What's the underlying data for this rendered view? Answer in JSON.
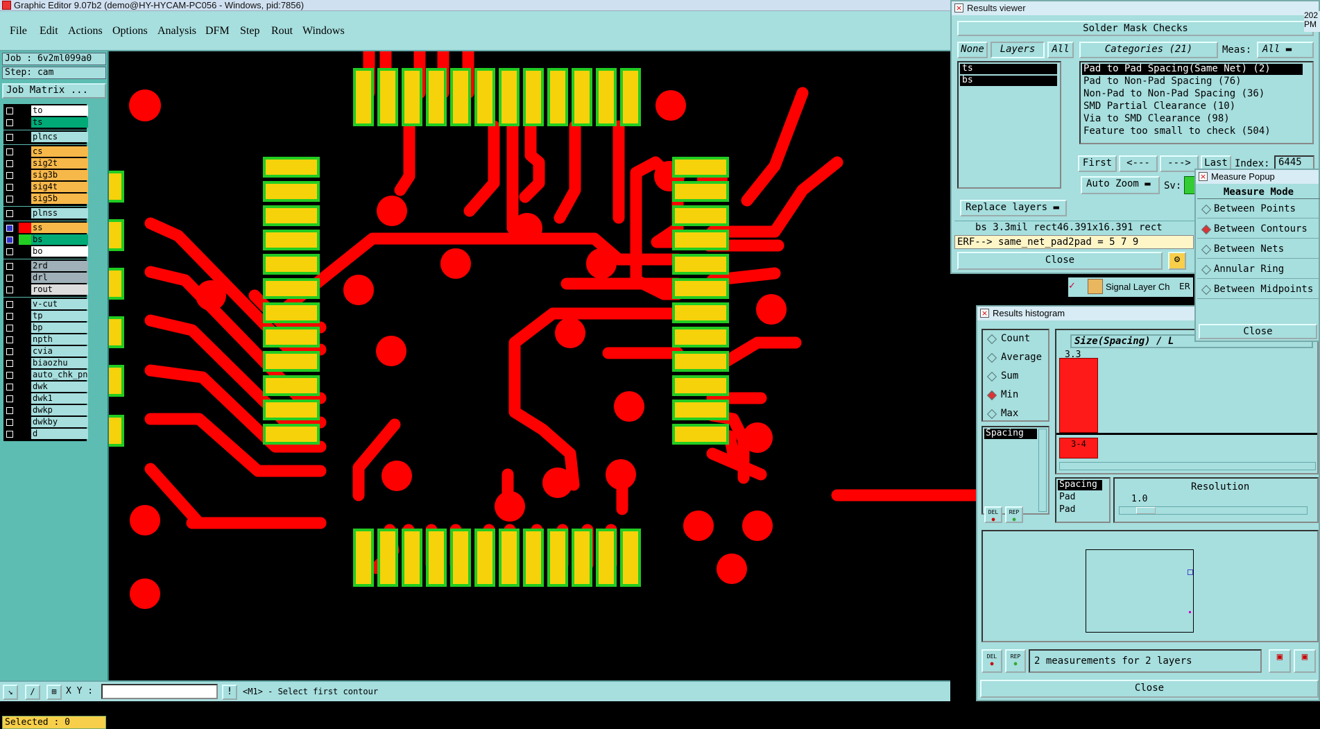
{
  "window_title": "Graphic Editor 9.07b2 (demo@HY-HYCAM-PC056 - Windows, pid:7856)",
  "menu": [
    "File",
    "Edit",
    "Actions",
    "Options",
    "Analysis",
    "DFM",
    "Step",
    "Rout",
    "Windows"
  ],
  "job": "Job : 6v2ml099a0",
  "step": "Step: cam",
  "job_matrix": "Job Matrix ...",
  "layers": [
    {
      "name": "to",
      "color": "#ffffff",
      "bg": "#ffffff",
      "sel": false
    },
    {
      "name": "ts",
      "color": "#00aa77",
      "bg": "#00aa77",
      "sel": false
    },
    {
      "name": "plncs",
      "color": "#000000",
      "bg": "#a7dede",
      "sel": false
    },
    {
      "name": "cs",
      "color": "#f7b84a",
      "bg": "#f7b84a",
      "sel": false
    },
    {
      "name": "sig2t",
      "color": "#f7b84a",
      "bg": "#f7b84a",
      "sel": false
    },
    {
      "name": "sig3b",
      "color": "#f7b84a",
      "bg": "#f7b84a",
      "sel": false
    },
    {
      "name": "sig4t",
      "color": "#f7b84a",
      "bg": "#f7b84a",
      "sel": false
    },
    {
      "name": "sig5b",
      "color": "#f7b84a",
      "bg": "#f7b84a",
      "sel": false
    },
    {
      "name": "plnss",
      "color": "#000000",
      "bg": "#a7dede",
      "sel": false
    },
    {
      "name": "ss",
      "color": "#ff0000",
      "bg": "#f7b84a",
      "sel": true
    },
    {
      "name": "bs",
      "color": "#22cc22",
      "bg": "#00aa77",
      "sel": true
    },
    {
      "name": "bo",
      "color": "#000000",
      "bg": "#ffffff",
      "sel": false
    },
    {
      "name": "2rd",
      "color": "#000000",
      "bg": "#9fb0b8",
      "sel": false
    },
    {
      "name": "drl",
      "color": "#000000",
      "bg": "#9fb0b8",
      "sel": false
    },
    {
      "name": "rout",
      "color": "#000000",
      "bg": "#dddddd",
      "sel": false
    },
    {
      "name": "v-cut",
      "color": "#000000",
      "bg": "#a7dede",
      "sel": false
    },
    {
      "name": "tp",
      "color": "#000000",
      "bg": "#a7dede",
      "sel": false
    },
    {
      "name": "bp",
      "color": "#000000",
      "bg": "#a7dede",
      "sel": false
    },
    {
      "name": "npth",
      "color": "#000000",
      "bg": "#a7dede",
      "sel": false
    },
    {
      "name": "cvia",
      "color": "#000000",
      "bg": "#a7dede",
      "sel": false
    },
    {
      "name": "biaozhu",
      "color": "#000000",
      "bg": "#a7dede",
      "sel": false
    },
    {
      "name": "auto_chk_pn:",
      "color": "#000000",
      "bg": "#a7dede",
      "sel": false
    },
    {
      "name": "dwk",
      "color": "#000000",
      "bg": "#a7dede",
      "sel": false
    },
    {
      "name": "dwk1",
      "color": "#000000",
      "bg": "#a7dede",
      "sel": false
    },
    {
      "name": "dwkp",
      "color": "#000000",
      "bg": "#a7dede",
      "sel": false
    },
    {
      "name": "dwkby",
      "color": "#000000",
      "bg": "#a7dede",
      "sel": false
    },
    {
      "name": "d",
      "color": "#000000",
      "bg": "#a7dede",
      "sel": false
    }
  ],
  "selected": "Selected : 0",
  "xy_label": "X Y :",
  "status_prompt": "<M1> - Select first contour",
  "results_viewer": {
    "title": "Results viewer",
    "header": "Solder Mask Checks",
    "none": "None",
    "layers": "Layers",
    "all": "All",
    "categories": "Categories (21)",
    "meas_label": "Meas:",
    "meas_value": "All",
    "layer_list": [
      "ts",
      "bs"
    ],
    "category_list": [
      "Pad to Pad Spacing(Same Net) (2)",
      "Pad to Non-Pad Spacing (76)",
      "Non-Pad to Non-Pad Spacing (36)",
      "SMD Partial Clearance (10)",
      "Via to SMD Clearance (98)",
      "Feature too small to check (504)"
    ],
    "first": "First",
    "prev": "<---",
    "next": "--->",
    "last": "Last",
    "index_label": "Index:",
    "index_value": "6445",
    "auto_zoom": "Auto Zoom",
    "sv": "Sv:",
    "replace_layers": "Replace layers",
    "info_line": "bs 3.3mil  rect46.391x16.391  rect",
    "erf_line": "ERF--> same_net_pad2pad = 5 7 9",
    "close": "Close"
  },
  "signal_layer": "Signal Layer Ch",
  "signal_suffix": "ER",
  "measure_popup": {
    "title": "Measure Popup",
    "mode_header": "Measure Mode",
    "modes": [
      "Between Points",
      "Between Contours",
      "Between Nets",
      "Annular Ring",
      "Between Midpoints"
    ],
    "selected_index": 1,
    "close": "Close"
  },
  "histogram": {
    "title": "Results histogram",
    "stats": [
      "Count",
      "Average",
      "Sum",
      "Min",
      "Max"
    ],
    "stat_selected": "Min",
    "spacing_label": "Spacing",
    "axis_title": "Size(Spacing) / L",
    "bar_value": "3.3",
    "bar_range": "3-4",
    "meas_types": [
      "Spacing",
      "Pad",
      "Pad"
    ],
    "resolution_label": "Resolution",
    "resolution_value": "1.0",
    "del": "DEL",
    "rep": "REP",
    "summary": "2 measurements for 2 layers",
    "close": "Close"
  },
  "side_digits": [
    "202",
    "PM"
  ]
}
